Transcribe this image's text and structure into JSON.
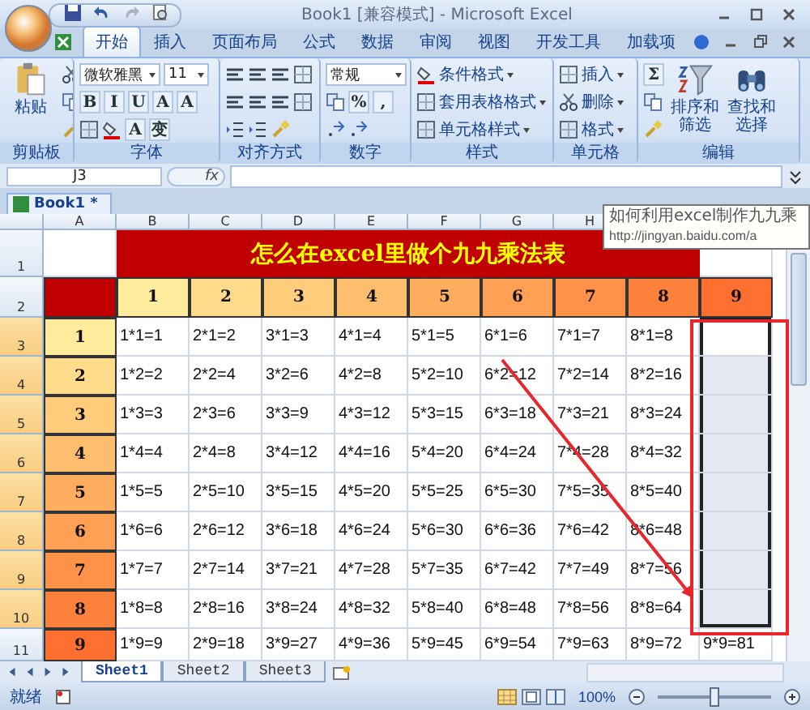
{
  "window": {
    "title": "Book1  [兼容模式] - Microsoft Excel"
  },
  "ribbon_tabs": [
    {
      "label": "开始",
      "selected": true
    },
    {
      "label": "插入",
      "selected": false
    },
    {
      "label": "页面布局",
      "selected": false
    },
    {
      "label": "公式",
      "selected": false
    },
    {
      "label": "数据",
      "selected": false
    },
    {
      "label": "审阅",
      "selected": false
    },
    {
      "label": "视图",
      "selected": false
    },
    {
      "label": "开发工具",
      "selected": false
    },
    {
      "label": "加载项",
      "selected": false
    }
  ],
  "ribbon_groups": [
    {
      "label": "剪贴板",
      "items": [
        {
          "kind": "large",
          "label": "粘贴"
        },
        {
          "kind": "row",
          "controls": [
            {
              "kind": "icon"
            }
          ]
        },
        {
          "kind": "row",
          "controls": [
            {
              "kind": "icon"
            }
          ]
        },
        {
          "kind": "row",
          "controls": [
            {
              "kind": "icon"
            }
          ]
        }
      ]
    },
    {
      "label": "字体",
      "items": [
        {
          "kind": "row",
          "controls": [
            {
              "kind": "field",
              "text": "微软雅黑"
            },
            {
              "kind": "field",
              "text": "11"
            }
          ]
        },
        {
          "kind": "row",
          "controls": [
            {
              "kind": "text",
              "text": "B"
            },
            {
              "kind": "text",
              "text": "I"
            },
            {
              "kind": "text",
              "text": "U"
            },
            {
              "kind": "text",
              "text": "A"
            },
            {
              "kind": "text",
              "text": "A"
            }
          ]
        },
        {
          "kind": "row",
          "controls": [
            {
              "kind": "icon"
            },
            {
              "kind": "icon"
            },
            {
              "kind": "text",
              "text": "A"
            },
            {
              "kind": "text",
              "text": "变"
            }
          ]
        }
      ]
    },
    {
      "label": "对齐方式",
      "items": [
        {
          "kind": "row",
          "controls": [
            {
              "kind": "icon"
            },
            {
              "kind": "icon"
            },
            {
              "kind": "icon"
            },
            {
              "kind": "icon"
            }
          ]
        },
        {
          "kind": "row",
          "controls": [
            {
              "kind": "icon"
            },
            {
              "kind": "icon"
            },
            {
              "kind": "icon"
            },
            {
              "kind": "icon"
            }
          ]
        },
        {
          "kind": "row",
          "controls": [
            {
              "kind": "icon"
            },
            {
              "kind": "icon"
            },
            {
              "kind": "icon"
            }
          ]
        }
      ]
    },
    {
      "label": "数字",
      "items": [
        {
          "kind": "row",
          "controls": [
            {
              "kind": "field",
              "text": "常规"
            }
          ]
        },
        {
          "kind": "row",
          "controls": [
            {
              "kind": "icon"
            },
            {
              "kind": "text",
              "text": "%"
            },
            {
              "kind": "text",
              "text": ","
            }
          ]
        },
        {
          "kind": "row",
          "controls": [
            {
              "kind": "icon"
            },
            {
              "kind": "icon"
            }
          ]
        }
      ]
    },
    {
      "label": "样式",
      "items": [
        {
          "kind": "small",
          "label": "条件格式"
        },
        {
          "kind": "small",
          "label": "套用表格格式"
        },
        {
          "kind": "small",
          "label": "单元格样式"
        }
      ]
    },
    {
      "label": "单元格",
      "items": [
        {
          "kind": "small",
          "label": "插入"
        },
        {
          "kind": "small",
          "label": "删除"
        },
        {
          "kind": "small",
          "label": "格式"
        }
      ]
    },
    {
      "label": "编辑",
      "items": [
        {
          "kind": "row",
          "controls": [
            {
              "kind": "text",
              "text": "Σ"
            }
          ]
        },
        {
          "kind": "row",
          "controls": [
            {
              "kind": "icon"
            }
          ]
        },
        {
          "kind": "row",
          "controls": [
            {
              "kind": "icon"
            }
          ]
        },
        {
          "kind": "large",
          "label": "排序和筛选"
        },
        {
          "kind": "large",
          "label": "查找和选择"
        }
      ]
    }
  ],
  "formula_bar": {
    "name_box": "J3",
    "function_label": "fx"
  },
  "workbook_tab": {
    "label": "Book1 *"
  },
  "tooltip": {
    "lines": [
      "如何利用excel制作九九乘",
      "http://jingyan.baidu.com/a"
    ]
  },
  "column_headers": [
    "A",
    "B",
    "C",
    "D",
    "E",
    "F",
    "G",
    "H"
  ],
  "rows": [
    {
      "number": "1",
      "kind": "title",
      "text": "怎么在excel里做个九九乘法表"
    },
    {
      "number": "2",
      "kind": "header",
      "corner": {
        "color": "#c00000"
      },
      "cells": [
        {
          "text": "1",
          "color": "#ffeb9c"
        },
        {
          "text": "2",
          "color": "#ffdc8c"
        },
        {
          "text": "3",
          "color": "#ffcc7c"
        },
        {
          "text": "4",
          "color": "#ffbd6e"
        },
        {
          "text": "5",
          "color": "#ffae60"
        },
        {
          "text": "6",
          "color": "#ffa054"
        },
        {
          "text": "7",
          "color": "#ff9148"
        },
        {
          "text": "8",
          "color": "#ff823c"
        },
        {
          "text": "9",
          "color": "#ff7030"
        }
      ]
    },
    {
      "number": "3",
      "kind": "data",
      "label": {
        "text": "1",
        "color": "#ffeb9c"
      },
      "cells": [
        "1*1=1",
        "2*1=2",
        "3*1=3",
        "4*1=4",
        "5*1=5",
        "6*1=6",
        "7*1=7",
        "8*1=8"
      ],
      "j_cell": {
        "selected": true
      }
    },
    {
      "number": "4",
      "kind": "data",
      "label": {
        "text": "2",
        "color": "#ffdc8c"
      },
      "cells": [
        "1*2=2",
        "2*2=4",
        "3*2=6",
        "4*2=8",
        "5*2=10",
        "6*2=12",
        "7*2=14",
        "8*2=16"
      ],
      "j_cell": {
        "selected": true
      }
    },
    {
      "number": "5",
      "kind": "data",
      "label": {
        "text": "3",
        "color": "#ffcc7c"
      },
      "cells": [
        "1*3=3",
        "2*3=6",
        "3*3=9",
        "4*3=12",
        "5*3=15",
        "6*3=18",
        "7*3=21",
        "8*3=24"
      ],
      "j_cell": {
        "selected": true
      }
    },
    {
      "number": "6",
      "kind": "data",
      "label": {
        "text": "4",
        "color": "#ffbd6e"
      },
      "cells": [
        "1*4=4",
        "2*4=8",
        "3*4=12",
        "4*4=16",
        "5*4=20",
        "6*4=24",
        "7*4=28",
        "8*4=32"
      ],
      "j_cell": {
        "selected": true
      }
    },
    {
      "number": "7",
      "kind": "data",
      "label": {
        "text": "5",
        "color": "#ffae60"
      },
      "cells": [
        "1*5=5",
        "2*5=10",
        "3*5=15",
        "4*5=20",
        "5*5=25",
        "6*5=30",
        "7*5=35",
        "8*5=40"
      ],
      "j_cell": {
        "selected": true
      }
    },
    {
      "number": "8",
      "kind": "data",
      "label": {
        "text": "6",
        "color": "#ffa054"
      },
      "cells": [
        "1*6=6",
        "2*6=12",
        "3*6=18",
        "4*6=24",
        "5*6=30",
        "6*6=36",
        "7*6=42",
        "8*6=48"
      ],
      "j_cell": {
        "selected": true
      }
    },
    {
      "number": "9",
      "kind": "data",
      "label": {
        "text": "7",
        "color": "#ff9148"
      },
      "cells": [
        "1*7=7",
        "2*7=14",
        "3*7=21",
        "4*7=28",
        "5*7=35",
        "6*7=42",
        "7*7=49",
        "8*7=56"
      ],
      "j_cell": {
        "selected": true
      }
    },
    {
      "number": "10",
      "kind": "data",
      "label": {
        "text": "8",
        "color": "#ff823c"
      },
      "cells": [
        "1*8=8",
        "2*8=16",
        "3*8=24",
        "4*8=32",
        "5*8=40",
        "6*8=48",
        "7*8=56",
        "8*8=64"
      ],
      "j_cell": {
        "selected": true
      }
    },
    {
      "number": "11",
      "kind": "data",
      "label": {
        "text": "9",
        "color": "#ff7030"
      },
      "cells": [
        "1*9=9",
        "2*9=18",
        "3*9=27",
        "4*9=36",
        "5*9=45",
        "6*9=54",
        "7*9=63",
        "8*9=72"
      ],
      "j_cell": {
        "text": "9*9=81",
        "selected": false
      }
    }
  ],
  "annotations": [
    {
      "kind": "box"
    },
    {
      "kind": "arrow"
    }
  ],
  "sheet_tabs": [
    {
      "label": "Sheet1",
      "selected": true
    },
    {
      "label": "Sheet2",
      "selected": false
    },
    {
      "label": "Sheet3",
      "selected": false
    }
  ],
  "status_bar": {
    "status": "就绪",
    "zoom": {
      "label": "100%",
      "level": 0.5
    }
  }
}
